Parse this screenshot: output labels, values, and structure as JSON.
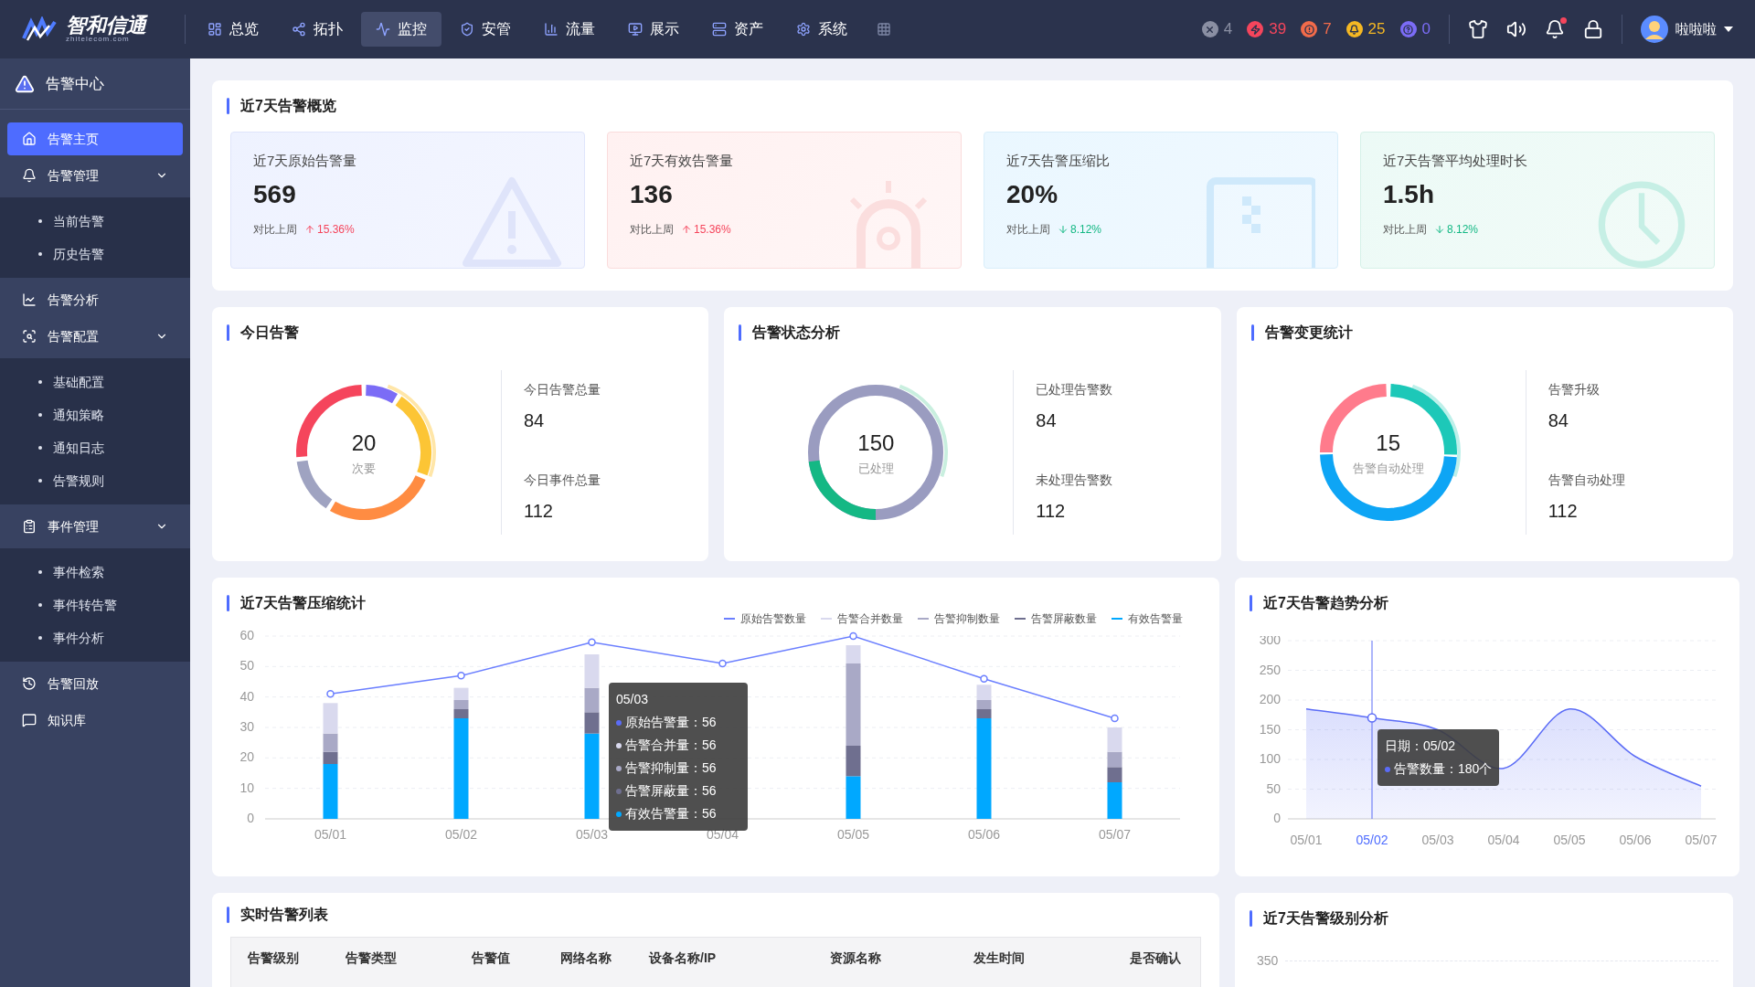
{
  "header": {
    "logo": "智和信通",
    "logo_sub": "zhitelecom.com",
    "nav": [
      {
        "label": "总览",
        "selected": false
      },
      {
        "label": "拓扑",
        "selected": false
      },
      {
        "label": "监控",
        "selected": true
      },
      {
        "label": "安管",
        "selected": false
      },
      {
        "label": "流量",
        "selected": false
      },
      {
        "label": "展示",
        "selected": false
      },
      {
        "label": "资产",
        "selected": false
      },
      {
        "label": "系统",
        "selected": false
      }
    ],
    "counters": [
      {
        "value": "4",
        "color": "#8a8fa3"
      },
      {
        "value": "39",
        "color": "#f5455c"
      },
      {
        "value": "7",
        "color": "#f26b4a"
      },
      {
        "value": "25",
        "color": "#f5b823"
      },
      {
        "value": "0",
        "color": "#7b6cf6"
      }
    ],
    "notification_dot": true,
    "user": "啦啦啦"
  },
  "sidebar": {
    "title": "告警中心",
    "items": [
      {
        "label": "告警主页",
        "selected": true
      },
      {
        "label": "告警管理",
        "selected": false,
        "expanded": true,
        "children": [
          {
            "label": "当前告警",
            "selected": false
          },
          {
            "label": "历史告警",
            "selected": false
          }
        ]
      },
      {
        "label": "告警分析",
        "selected": false
      },
      {
        "label": "告警配置",
        "selected": false,
        "expanded": true,
        "children": [
          {
            "label": "基础配置",
            "selected": false
          },
          {
            "label": "通知策略",
            "selected": false
          },
          {
            "label": "通知日志",
            "selected": false
          },
          {
            "label": "告警规则",
            "selected": false
          }
        ]
      },
      {
        "label": "事件管理",
        "selected": false,
        "expanded": true,
        "children": [
          {
            "label": "事件检索",
            "selected": false
          },
          {
            "label": "事件转告警",
            "selected": false
          },
          {
            "label": "事件分析",
            "selected": false
          }
        ]
      },
      {
        "label": "告警回放",
        "selected": false
      },
      {
        "label": "知识库",
        "selected": false
      }
    ]
  },
  "overview": {
    "title": "近7天告警概览",
    "cards": [
      {
        "kind": "warning",
        "label": "近7天原始告警量",
        "value": "569",
        "compare": "对比上周",
        "change": "15.36%",
        "rising": true
      },
      {
        "kind": "alarm",
        "label": "近7天有效告警量",
        "value": "136",
        "compare": "对比上周",
        "change": "15.36%",
        "rising": true
      },
      {
        "kind": "ratio",
        "label": "近7天告警压缩比",
        "value": "20%",
        "compare": "对比上周",
        "change": "8.12%",
        "rising": false
      },
      {
        "kind": "clock",
        "label": "近7天告警平均处理时长",
        "value": "1.5h",
        "compare": "对比上周",
        "change": "8.12%",
        "rising": false
      }
    ]
  },
  "donut_panels": [
    {
      "kind": "severity",
      "title": "今日告警",
      "center_value": "20",
      "center_label": "次要",
      "stats": [
        {
          "label": "今日告警总量",
          "value": "84"
        },
        {
          "label": "今日事件总量",
          "value": "112"
        }
      ]
    },
    {
      "kind": "status",
      "title": "告警状态分析",
      "center_value": "150",
      "center_label": "已处理",
      "stats": [
        {
          "label": "已处理告警数",
          "value": "84"
        },
        {
          "label": "未处理告警数",
          "value": "112"
        }
      ]
    },
    {
      "kind": "change",
      "title": "告警变更统计",
      "center_value": "15",
      "center_label": "告警自动处理",
      "stats": [
        {
          "label": "告警升级",
          "value": "84"
        },
        {
          "label": "告警自动处理",
          "value": "112"
        }
      ]
    }
  ],
  "compression": {
    "title": "近7天告警压缩统计",
    "chart_data": {
      "type": "bar",
      "stacked": true,
      "grid": true,
      "categories": [
        "05/01",
        "05/02",
        "05/03",
        "05/04",
        "05/05",
        "05/06",
        "05/07"
      ],
      "yticks": [
        0,
        10,
        20,
        30,
        40,
        50,
        60
      ],
      "ylim": [
        0,
        60
      ],
      "series": [
        {
          "name": "原始告警数量",
          "color": "#6b7fff",
          "type": "line",
          "marker": "circle",
          "values": [
            41,
            47,
            58,
            51,
            60,
            46,
            33
          ]
        },
        {
          "name": "告警合并数量",
          "color": "#d9d9ee",
          "type": "bar",
          "values": [
            10,
            4,
            11,
            null,
            6,
            5,
            8
          ]
        },
        {
          "name": "告警抑制数量",
          "color": "#a9a9c6",
          "type": "bar",
          "values": [
            6,
            3,
            8,
            null,
            27,
            3,
            5
          ]
        },
        {
          "name": "告警屏蔽数量",
          "color": "#6f6f8f",
          "type": "bar",
          "values": [
            4,
            3,
            7,
            null,
            10,
            3,
            5
          ]
        },
        {
          "name": "有效告警量",
          "color": "#00a8ff",
          "type": "bar",
          "values": [
            18,
            33,
            28,
            null,
            14,
            33,
            12
          ]
        }
      ]
    },
    "tooltip": {
      "title": "05/03",
      "rows": [
        {
          "label": "原始告警量：",
          "value": "56",
          "color": "#5b6cf6"
        },
        {
          "label": "告警合并量：",
          "value": "56",
          "color": "#d9d9ee"
        },
        {
          "label": "告警抑制量：",
          "value": "56",
          "color": "#a9a9c6"
        },
        {
          "label": "告警屏蔽量：",
          "value": "56",
          "color": "#6f6f8f"
        },
        {
          "label": "有效告警量：",
          "value": "56",
          "color": "#00a8ff"
        }
      ]
    }
  },
  "trend": {
    "title": "近7天告警趋势分析",
    "chart_data": {
      "type": "area",
      "grid": true,
      "categories": [
        "05/01",
        "05/02",
        "05/03",
        "05/04",
        "05/05",
        "05/06",
        "05/07"
      ],
      "yticks": [
        0,
        50,
        100,
        150,
        200,
        250,
        300
      ],
      "ylim": [
        0,
        300
      ],
      "series": [
        {
          "color": "#5b6cf6",
          "values": [
            185,
            170,
            150,
            85,
            185,
            105,
            55
          ]
        }
      ],
      "ref_lines": [
        {
          "axis": "x",
          "value": "05/02"
        }
      ]
    },
    "highlighted_categories": [
      false,
      true,
      false,
      false,
      false,
      false,
      false
    ],
    "tooltip": {
      "date": "日期：05/02",
      "label": "告警数量：",
      "value": "180个"
    }
  },
  "realtime": {
    "title": "实时告警列表",
    "columns": [
      "告警级别",
      "告警类型",
      "告警值",
      "网络名称",
      "设备名称/IP",
      "资源名称",
      "发生时间",
      "是否确认"
    ]
  },
  "level": {
    "title": "近7天告警级别分析",
    "ytick": "350"
  }
}
